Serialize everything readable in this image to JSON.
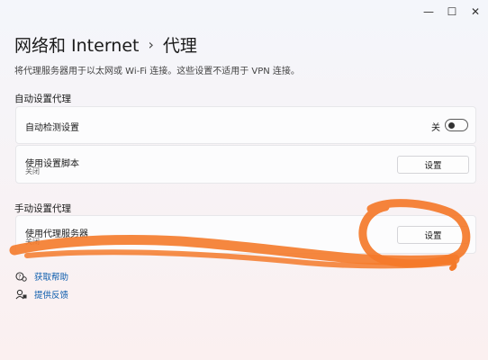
{
  "window": {
    "minimize_glyph": "—",
    "maximize_glyph": "☐",
    "close_glyph": "✕"
  },
  "header": {
    "breadcrumb_root": "网络和 Internet",
    "separator": "›",
    "current": "代理"
  },
  "description": "将代理服务器用于以太网或 Wi-Fi 连接。这些设置不适用于 VPN 连接。",
  "auto_proxy": {
    "section_title": "自动设置代理",
    "detect": {
      "label": "自动检测设置",
      "state_text": "关",
      "enabled": false
    },
    "script": {
      "label": "使用设置脚本",
      "status": "关闭",
      "button_label": "设置"
    }
  },
  "manual_proxy": {
    "section_title": "手动设置代理",
    "server": {
      "label": "使用代理服务器",
      "status": "关闭",
      "button_label": "设置"
    }
  },
  "links": [
    {
      "icon": "help-icon",
      "label": "获取帮助"
    },
    {
      "icon": "feedback-icon",
      "label": "提供反馈"
    }
  ],
  "annotation_color": "#f47a2a"
}
